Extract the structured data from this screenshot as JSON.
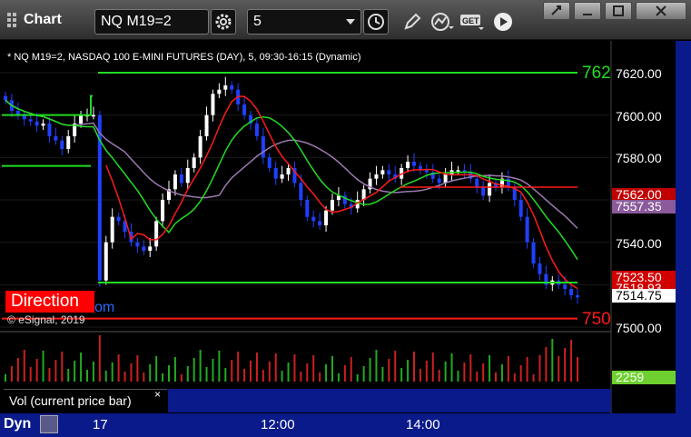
{
  "window": {
    "title": "Chart",
    "symbol_value": "NQ M19=2",
    "interval_value": "5"
  },
  "chart": {
    "description": "* NQ M19=2, NASDAQ 100 E-MINI FUTURES (DAY), 5, 09:30-16:15 (Dynamic)",
    "price_axis": [
      "7620.00",
      "7600.00",
      "7580.00",
      "7560.00",
      "7540.00",
      "7520.00",
      "7500.00"
    ],
    "tags": {
      "top_green": "762",
      "bottom_red": "750",
      "sma_red": "7562.00",
      "sma_purple": "7557.35",
      "level_red": "7523.50",
      "level_red2": "7518.93",
      "last_price": "7514.75"
    },
    "direction_label": "Direction",
    "direction_suffix": "om",
    "copyright": "© eSignal, 2019",
    "colors": {
      "up_candle": "#ffffff",
      "down_candle": "#2040ff",
      "ma_red": "#ff1a1a",
      "ma_green": "#22dd22",
      "ma_purple": "#9a7ab0",
      "level_green": "#22dd22",
      "level_red": "#ff1a1a"
    }
  },
  "volume": {
    "label": "Vol (current price bar)",
    "close": "×",
    "value": "2259"
  },
  "timebar": {
    "mode": "Dyn",
    "labels": [
      "17",
      "12:00",
      "14:00"
    ]
  }
}
